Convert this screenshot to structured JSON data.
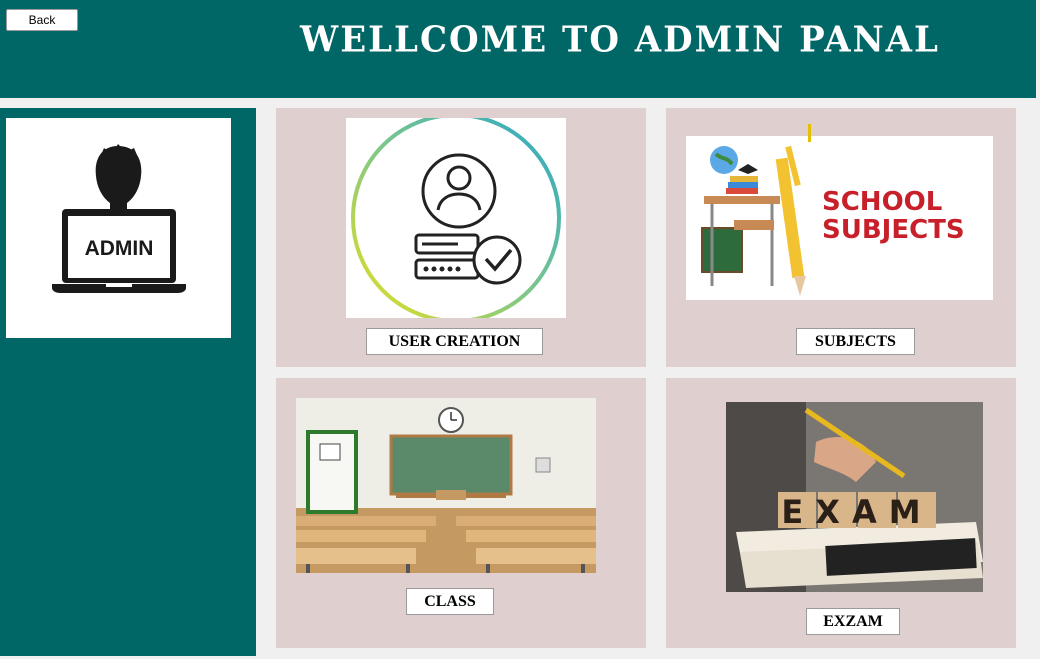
{
  "header": {
    "back_label": "Back",
    "title": "WELLCOME TO ADMIN PANAL"
  },
  "sidebar": {
    "admin_label": "ADMIN"
  },
  "cards": {
    "user_creation": {
      "button_label": "USER CREATION"
    },
    "subjects": {
      "button_label": "SUBJECTS",
      "image_text_line1": "SCHOOL",
      "image_text_line2": "SUBJECTS"
    },
    "class": {
      "button_label": "CLASS"
    },
    "exam": {
      "button_label": "EXZAM",
      "image_text": "EXAM"
    }
  },
  "colors": {
    "brand": "#006666",
    "card_bg": "#dfcfcf",
    "background": "#f0f0f0"
  }
}
